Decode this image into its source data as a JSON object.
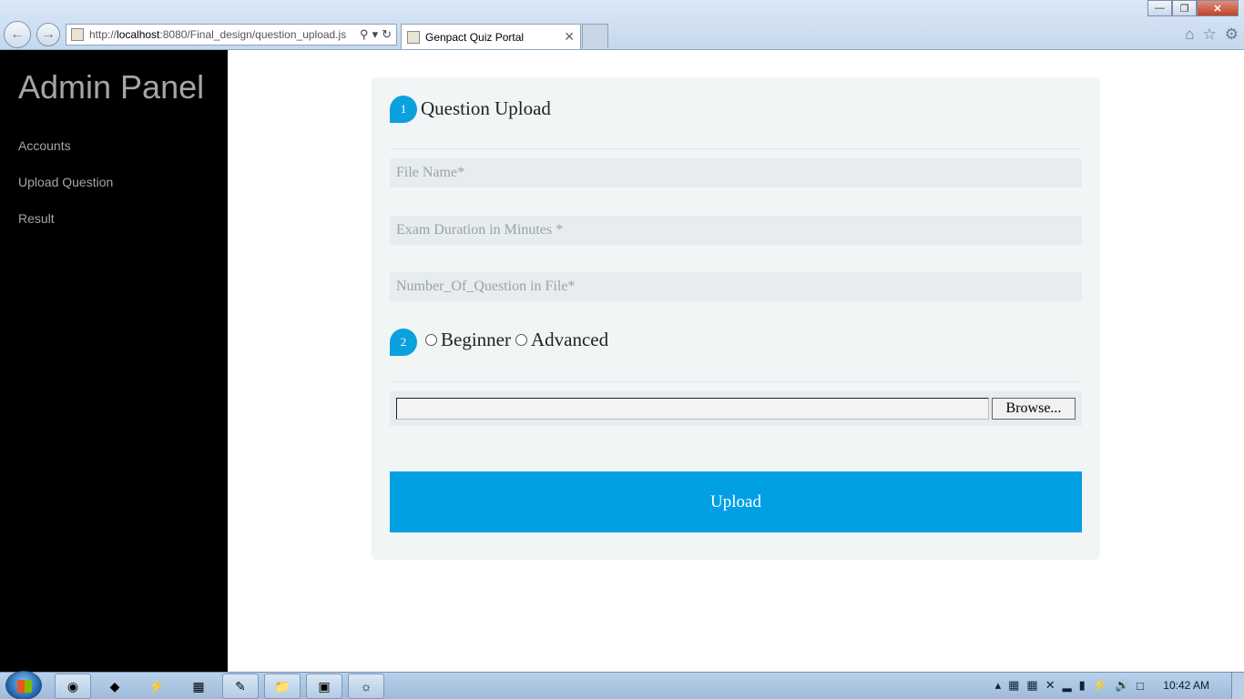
{
  "browser": {
    "url_prefix": "http://",
    "url_host": "localhost",
    "url_rest": ":8080/Final_design/question_upload.js",
    "tab_title": "Genpact Quiz Portal"
  },
  "sidebar": {
    "title": "Admin Panel",
    "items": [
      {
        "label": "Accounts"
      },
      {
        "label": "Upload Question"
      },
      {
        "label": "Result"
      }
    ]
  },
  "form": {
    "step1_number": "1",
    "step1_title": "Question Upload",
    "file_name_placeholder": "File Name*",
    "duration_placeholder": "Exam Duration in Minutes *",
    "question_count_placeholder": "Number_Of_Question in File*",
    "step2_number": "2",
    "level_options": [
      "Beginner",
      "Advanced"
    ],
    "browse_label": "Browse...",
    "upload_label": "Upload"
  },
  "taskbar": {
    "clock": "10:42 AM"
  },
  "colors": {
    "accent": "#00a0e3",
    "sidebar_bg": "#000000",
    "sidebar_text": "#a5a5a5",
    "card_bg": "#f2f5f6"
  }
}
